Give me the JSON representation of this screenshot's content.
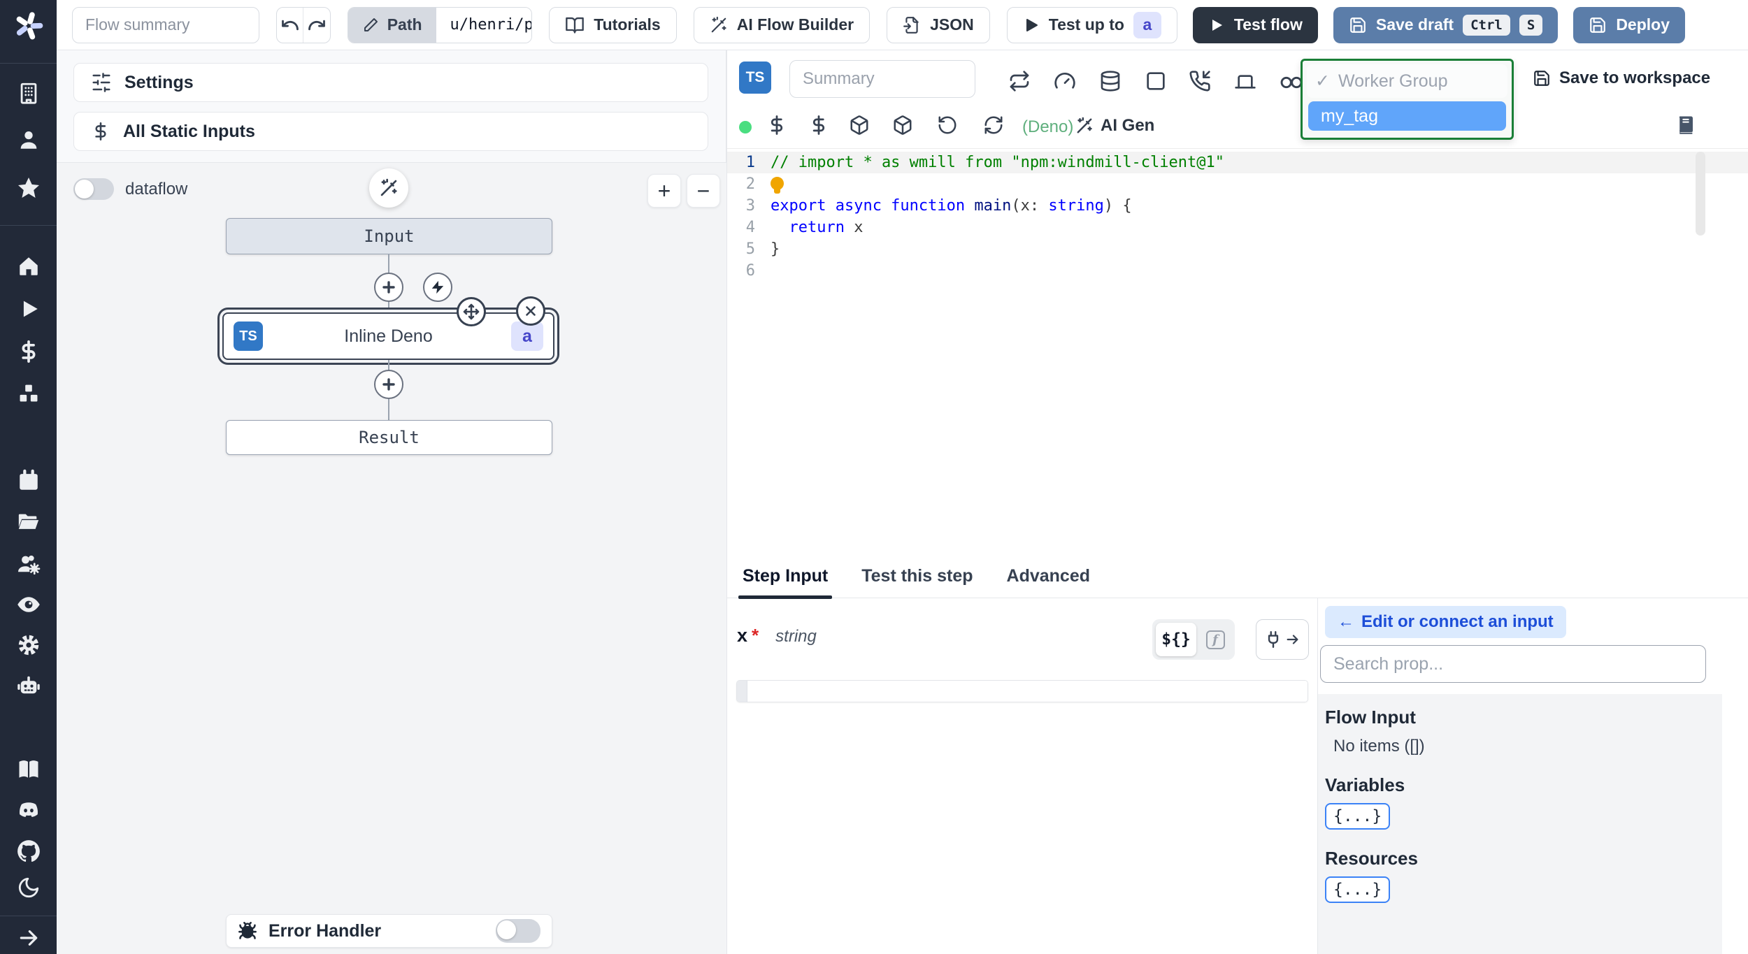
{
  "topbar": {
    "flow_summary_placeholder": "Flow summary",
    "path_label": "Path",
    "path_value": "u/henri/prolific_flow",
    "tutorials_label": "Tutorials",
    "ai_flow_builder_label": "AI Flow Builder",
    "json_label": "JSON",
    "test_up_to_label": "Test up to",
    "test_up_to_badge": "a",
    "test_flow_label": "Test flow",
    "save_draft_label": "Save draft",
    "kbd_ctrl": "Ctrl",
    "kbd_s": "S",
    "deploy_label": "Deploy"
  },
  "left_panel": {
    "settings_label": "Settings",
    "all_static_inputs_label": "All Static Inputs",
    "dataflow_label": "dataflow",
    "zoom_in": "+",
    "zoom_out": "−",
    "nodes": {
      "input": "Input",
      "inline_deno_ts": "TS",
      "inline_deno": "Inline Deno",
      "inline_deno_badge": "a",
      "result": "Result"
    },
    "error_handler_label": "Error Handler"
  },
  "editor": {
    "ts_badge": "TS",
    "summary_placeholder": "Summary",
    "lang_label": "(Deno)",
    "ai_gen_label": "AI Gen",
    "worker_group": {
      "placeholder": "Worker Group",
      "check": "✓",
      "selected_item": "my_tag"
    },
    "save_to_workspace_label": "Save to workspace",
    "code_lines": [
      {
        "n": "1",
        "active": true,
        "tokens": [
          {
            "text": "// import * as wmill from \"npm:windmill-client@1\"",
            "cls": "c-comment"
          }
        ]
      },
      {
        "n": "2",
        "tokens": [
          {
            "icon": "lightbulb"
          }
        ]
      },
      {
        "n": "3",
        "tokens": [
          {
            "text": "export async function ",
            "cls": "c-kw"
          },
          {
            "text": "main",
            "cls": "c-fn"
          },
          {
            "text": "(x: ",
            "cls": "c-plain"
          },
          {
            "text": "string",
            "cls": "c-kw"
          },
          {
            "text": ") {",
            "cls": "c-plain"
          }
        ]
      },
      {
        "n": "4",
        "tokens": [
          {
            "text": "  ",
            "cls": "c-plain"
          },
          {
            "text": "return",
            "cls": "c-kw"
          },
          {
            "text": " x",
            "cls": "c-plain"
          }
        ]
      },
      {
        "n": "5",
        "tokens": [
          {
            "text": "}",
            "cls": "c-plain"
          }
        ]
      },
      {
        "n": "6",
        "tokens": []
      }
    ]
  },
  "step_panel": {
    "tabs": [
      "Step Input",
      "Test this step",
      "Advanced"
    ],
    "field_name": "x",
    "required_marker": "*",
    "field_type": "string",
    "template_toggle_label": "${}",
    "fn_toggle_label": "f",
    "connect_arrow": "←",
    "connect_button_label": "Edit or connect an input",
    "search_placeholder": "Search prop...",
    "flow_input_heading": "Flow Input",
    "flow_input_empty": "No items ([])",
    "variables_heading": "Variables",
    "variables_chip": "{...}",
    "resources_heading": "Resources",
    "resources_chip": "{...}"
  }
}
